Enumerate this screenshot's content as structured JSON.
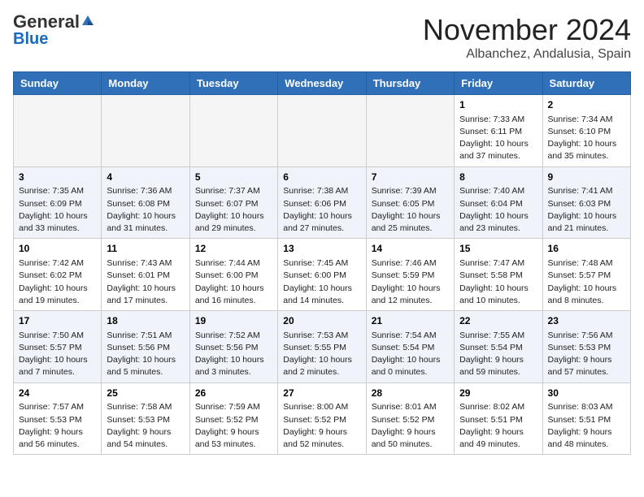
{
  "header": {
    "logo_general": "General",
    "logo_blue": "Blue",
    "month_title": "November 2024",
    "location": "Albanchez, Andalusia, Spain"
  },
  "days_of_week": [
    "Sunday",
    "Monday",
    "Tuesday",
    "Wednesday",
    "Thursday",
    "Friday",
    "Saturday"
  ],
  "weeks": [
    {
      "alt": false,
      "days": [
        {
          "num": "",
          "info": "",
          "empty": true
        },
        {
          "num": "",
          "info": "",
          "empty": true
        },
        {
          "num": "",
          "info": "",
          "empty": true
        },
        {
          "num": "",
          "info": "",
          "empty": true
        },
        {
          "num": "",
          "info": "",
          "empty": true
        },
        {
          "num": "1",
          "info": "Sunrise: 7:33 AM\nSunset: 6:11 PM\nDaylight: 10 hours\nand 37 minutes.",
          "empty": false
        },
        {
          "num": "2",
          "info": "Sunrise: 7:34 AM\nSunset: 6:10 PM\nDaylight: 10 hours\nand 35 minutes.",
          "empty": false
        }
      ]
    },
    {
      "alt": true,
      "days": [
        {
          "num": "3",
          "info": "Sunrise: 7:35 AM\nSunset: 6:09 PM\nDaylight: 10 hours\nand 33 minutes.",
          "empty": false
        },
        {
          "num": "4",
          "info": "Sunrise: 7:36 AM\nSunset: 6:08 PM\nDaylight: 10 hours\nand 31 minutes.",
          "empty": false
        },
        {
          "num": "5",
          "info": "Sunrise: 7:37 AM\nSunset: 6:07 PM\nDaylight: 10 hours\nand 29 minutes.",
          "empty": false
        },
        {
          "num": "6",
          "info": "Sunrise: 7:38 AM\nSunset: 6:06 PM\nDaylight: 10 hours\nand 27 minutes.",
          "empty": false
        },
        {
          "num": "7",
          "info": "Sunrise: 7:39 AM\nSunset: 6:05 PM\nDaylight: 10 hours\nand 25 minutes.",
          "empty": false
        },
        {
          "num": "8",
          "info": "Sunrise: 7:40 AM\nSunset: 6:04 PM\nDaylight: 10 hours\nand 23 minutes.",
          "empty": false
        },
        {
          "num": "9",
          "info": "Sunrise: 7:41 AM\nSunset: 6:03 PM\nDaylight: 10 hours\nand 21 minutes.",
          "empty": false
        }
      ]
    },
    {
      "alt": false,
      "days": [
        {
          "num": "10",
          "info": "Sunrise: 7:42 AM\nSunset: 6:02 PM\nDaylight: 10 hours\nand 19 minutes.",
          "empty": false
        },
        {
          "num": "11",
          "info": "Sunrise: 7:43 AM\nSunset: 6:01 PM\nDaylight: 10 hours\nand 17 minutes.",
          "empty": false
        },
        {
          "num": "12",
          "info": "Sunrise: 7:44 AM\nSunset: 6:00 PM\nDaylight: 10 hours\nand 16 minutes.",
          "empty": false
        },
        {
          "num": "13",
          "info": "Sunrise: 7:45 AM\nSunset: 6:00 PM\nDaylight: 10 hours\nand 14 minutes.",
          "empty": false
        },
        {
          "num": "14",
          "info": "Sunrise: 7:46 AM\nSunset: 5:59 PM\nDaylight: 10 hours\nand 12 minutes.",
          "empty": false
        },
        {
          "num": "15",
          "info": "Sunrise: 7:47 AM\nSunset: 5:58 PM\nDaylight: 10 hours\nand 10 minutes.",
          "empty": false
        },
        {
          "num": "16",
          "info": "Sunrise: 7:48 AM\nSunset: 5:57 PM\nDaylight: 10 hours\nand 8 minutes.",
          "empty": false
        }
      ]
    },
    {
      "alt": true,
      "days": [
        {
          "num": "17",
          "info": "Sunrise: 7:50 AM\nSunset: 5:57 PM\nDaylight: 10 hours\nand 7 minutes.",
          "empty": false
        },
        {
          "num": "18",
          "info": "Sunrise: 7:51 AM\nSunset: 5:56 PM\nDaylight: 10 hours\nand 5 minutes.",
          "empty": false
        },
        {
          "num": "19",
          "info": "Sunrise: 7:52 AM\nSunset: 5:56 PM\nDaylight: 10 hours\nand 3 minutes.",
          "empty": false
        },
        {
          "num": "20",
          "info": "Sunrise: 7:53 AM\nSunset: 5:55 PM\nDaylight: 10 hours\nand 2 minutes.",
          "empty": false
        },
        {
          "num": "21",
          "info": "Sunrise: 7:54 AM\nSunset: 5:54 PM\nDaylight: 10 hours\nand 0 minutes.",
          "empty": false
        },
        {
          "num": "22",
          "info": "Sunrise: 7:55 AM\nSunset: 5:54 PM\nDaylight: 9 hours\nand 59 minutes.",
          "empty": false
        },
        {
          "num": "23",
          "info": "Sunrise: 7:56 AM\nSunset: 5:53 PM\nDaylight: 9 hours\nand 57 minutes.",
          "empty": false
        }
      ]
    },
    {
      "alt": false,
      "days": [
        {
          "num": "24",
          "info": "Sunrise: 7:57 AM\nSunset: 5:53 PM\nDaylight: 9 hours\nand 56 minutes.",
          "empty": false
        },
        {
          "num": "25",
          "info": "Sunrise: 7:58 AM\nSunset: 5:53 PM\nDaylight: 9 hours\nand 54 minutes.",
          "empty": false
        },
        {
          "num": "26",
          "info": "Sunrise: 7:59 AM\nSunset: 5:52 PM\nDaylight: 9 hours\nand 53 minutes.",
          "empty": false
        },
        {
          "num": "27",
          "info": "Sunrise: 8:00 AM\nSunset: 5:52 PM\nDaylight: 9 hours\nand 52 minutes.",
          "empty": false
        },
        {
          "num": "28",
          "info": "Sunrise: 8:01 AM\nSunset: 5:52 PM\nDaylight: 9 hours\nand 50 minutes.",
          "empty": false
        },
        {
          "num": "29",
          "info": "Sunrise: 8:02 AM\nSunset: 5:51 PM\nDaylight: 9 hours\nand 49 minutes.",
          "empty": false
        },
        {
          "num": "30",
          "info": "Sunrise: 8:03 AM\nSunset: 5:51 PM\nDaylight: 9 hours\nand 48 minutes.",
          "empty": false
        }
      ]
    }
  ]
}
